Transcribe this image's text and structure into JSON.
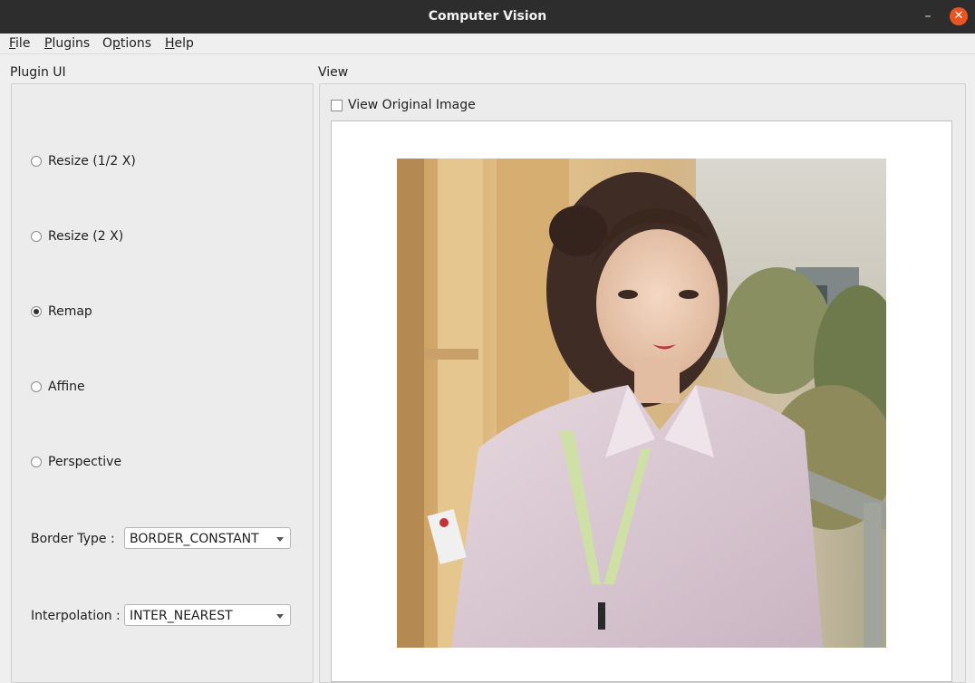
{
  "window": {
    "title": "Computer Vision"
  },
  "menubar": {
    "items": [
      {
        "mnemonic": "F",
        "rest": "ile"
      },
      {
        "mnemonic": "P",
        "rest": "lugins"
      },
      {
        "pre": "O",
        "mnemonic": "p",
        "rest": "tions"
      },
      {
        "mnemonic": "H",
        "rest": "elp"
      }
    ]
  },
  "plugin_ui": {
    "title": "Plugin UI",
    "options": [
      {
        "label": "Resize (1/2 X)",
        "checked": false
      },
      {
        "label": "Resize (2 X)",
        "checked": false
      },
      {
        "label": "Remap",
        "checked": true
      },
      {
        "label": "Affine",
        "checked": false
      },
      {
        "label": "Perspective",
        "checked": false
      }
    ],
    "border_type": {
      "label": "Border Type :",
      "value": "BORDER_CONSTANT"
    },
    "interpolation": {
      "label": "Interpolation :",
      "value": "INTER_NEAREST"
    }
  },
  "view": {
    "title": "View",
    "view_original": {
      "label": "View Original Image",
      "checked": false
    }
  },
  "colors": {
    "titlebar": "#2d2d2d",
    "close": "#e95420",
    "window": "#efefef"
  },
  "icons": {
    "minimize": "minimize-icon",
    "close": "close-icon"
  }
}
